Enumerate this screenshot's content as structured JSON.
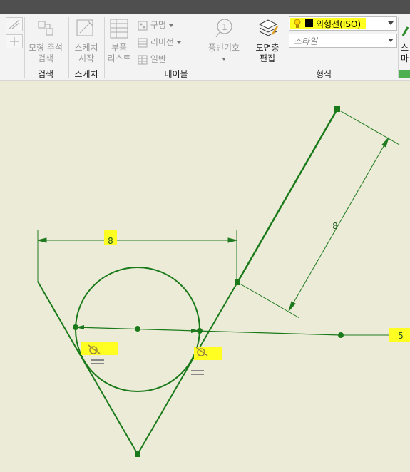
{
  "ribbon": {
    "search": {
      "model_note_search": [
        "모형 주석",
        "검색"
      ],
      "group": "검색"
    },
    "sketch": {
      "start_sketch": [
        "스케치",
        "시작"
      ],
      "group": "스케치"
    },
    "table": {
      "parts_list": [
        "부품",
        "리스트"
      ],
      "hole": "구멍",
      "revision": "리비전",
      "general": "일반",
      "balloon": "풍번기호",
      "group": "테이블"
    },
    "format": {
      "edit_layer": [
        "도면층",
        "편집"
      ],
      "layer_value": "외형선(ISO)",
      "layer_color": "#000000",
      "style_placeholder": "스타일",
      "group": "형식"
    },
    "right_clip": [
      "스",
      "마"
    ]
  },
  "drawing": {
    "dims": {
      "horizontal": "8",
      "slanted": "8",
      "right": "5"
    },
    "line_color": "#1a7a1a",
    "dim_color": "#1f7a1f",
    "highlight": "#ffff22"
  }
}
